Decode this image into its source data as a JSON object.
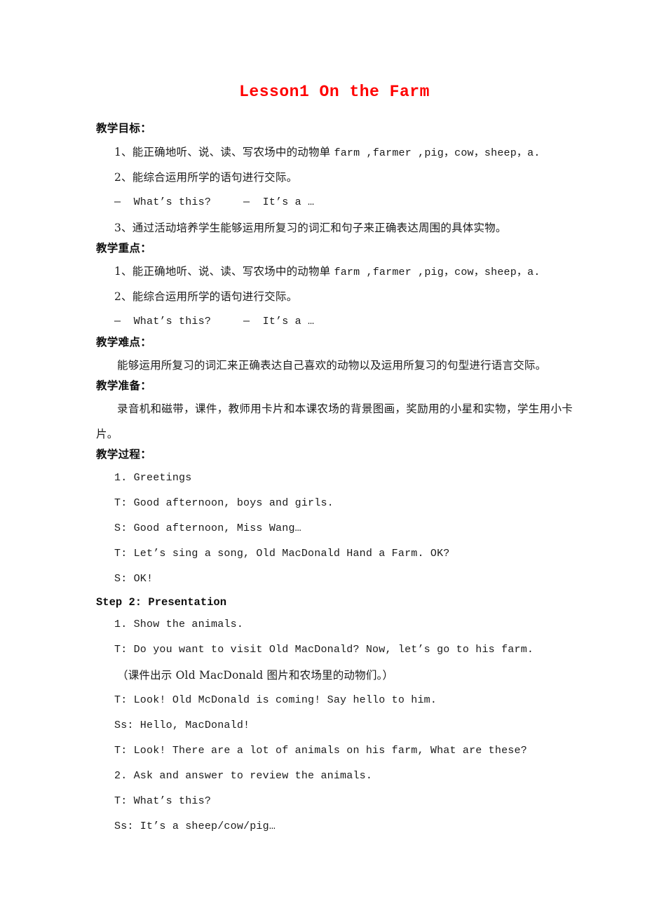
{
  "document": {
    "title": "Lesson1 On the Farm",
    "title_color": "#ff0000",
    "background_color": "#ffffff",
    "text_color": "#1a1a1a"
  },
  "sections": {
    "objectives": {
      "heading": "教学目标：",
      "item1_cjk": "1、能正确地听、说、读、写农场中的动物单 ",
      "item1_latin": "farm ,farmer ,pig，cow，sheep，a.",
      "item2": "2、能综合运用所学的语句进行交际。",
      "dialog": "—  What’s this?     —  It’s a …",
      "item3": "3、通过活动培养学生能够运用所复习的词汇和句子来正确表达周围的具体实物。"
    },
    "key_points": {
      "heading": "教学重点：",
      "item1_cjk": "1、能正确地听、说、读、写农场中的动物单 ",
      "item1_latin": "farm ,farmer ,pig，cow，sheep，a.",
      "item2": "2、能综合运用所学的语句进行交际。",
      "dialog": "—  What’s this?     —  It’s a …"
    },
    "difficult_points": {
      "heading": "教学难点：",
      "body": "能够运用所复习的词汇来正确表达自己喜欢的动物以及运用所复习的句型进行语言交际。"
    },
    "preparation": {
      "heading": "教学准备：",
      "body": "录音机和磁带，课件，教师用卡片和本课农场的背景图画，奖励用的小星和实物，学生用小卡片。"
    },
    "procedure": {
      "heading": "教学过程：",
      "lines": [
        "1. Greetings",
        "T: Good afternoon, boys and girls.",
        "S: Good afternoon, Miss Wang…",
        "T: Let’s sing a song, Old MacDonald Hand a Farm. OK?",
        "S: OK!"
      ]
    },
    "step2": {
      "heading": "Step 2: Presentation",
      "line1": "1. Show the animals.",
      "line2": "T: Do you want to visit Old MacDonald? Now, let’s go to his farm.",
      "line3": "（课件出示 Old MacDonald 图片和农场里的动物们。）",
      "line4": "T: Look! Old McDonald is coming! Say hello to him.",
      "line5": "Ss: Hello, MacDonald!",
      "line6": "T: Look! There are a lot of animals on his farm, What are these?",
      "line7": "2. Ask and answer to review the animals.",
      "line8": "T: What’s this?",
      "line9": "Ss: It’s a sheep/cow/pig…"
    }
  }
}
